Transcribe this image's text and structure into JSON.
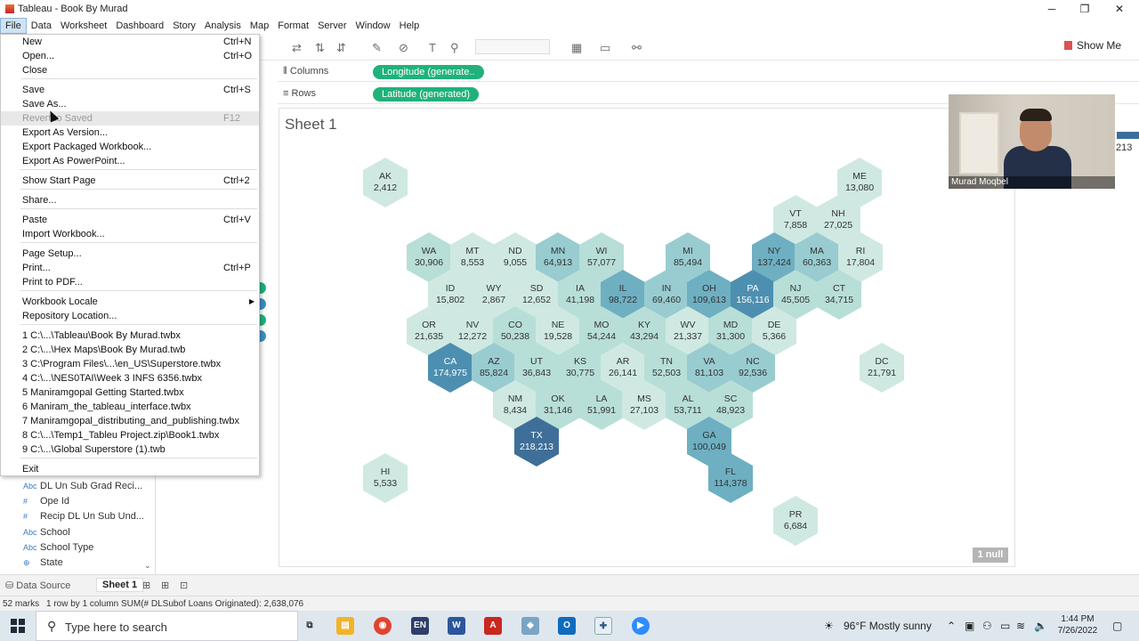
{
  "window": {
    "title": "Tableau - Book By Murad",
    "minimize": "─",
    "maximize": "❐",
    "close": "✕"
  },
  "menubar": [
    "File",
    "Data",
    "Worksheet",
    "Dashboard",
    "Story",
    "Analysis",
    "Map",
    "Format",
    "Server",
    "Window",
    "Help"
  ],
  "file_menu": {
    "items": [
      {
        "label": "New",
        "shortcut": "Ctrl+N"
      },
      {
        "label": "Open...",
        "shortcut": "Ctrl+O"
      },
      {
        "label": "Close",
        "shortcut": ""
      },
      {
        "label": "Save",
        "shortcut": "Ctrl+S"
      },
      {
        "label": "Save As...",
        "shortcut": ""
      },
      {
        "label": "Revert to Saved",
        "shortcut": "F12",
        "disabled": true
      },
      {
        "label": "Export As Version...",
        "shortcut": ""
      },
      {
        "label": "Export Packaged Workbook...",
        "shortcut": ""
      },
      {
        "label": "Export As PowerPoint...",
        "shortcut": ""
      },
      {
        "label": "Show Start Page",
        "shortcut": "Ctrl+2"
      },
      {
        "label": "Share...",
        "shortcut": ""
      },
      {
        "label": "Paste",
        "shortcut": "Ctrl+V"
      },
      {
        "label": "Import Workbook...",
        "shortcut": ""
      },
      {
        "label": "Page Setup...",
        "shortcut": ""
      },
      {
        "label": "Print...",
        "shortcut": "Ctrl+P"
      },
      {
        "label": "Print to PDF...",
        "shortcut": ""
      },
      {
        "label": "Workbook Locale",
        "shortcut": ""
      },
      {
        "label": "Repository Location...",
        "shortcut": ""
      },
      {
        "label": "1 C:\\...\\Tableau\\Book By Murad.twbx",
        "shortcut": ""
      },
      {
        "label": "2 C:\\...\\Hex Maps\\Book By Murad.twb",
        "shortcut": ""
      },
      {
        "label": "3 C:\\Program Files\\...\\en_US\\Superstore.twbx",
        "shortcut": ""
      },
      {
        "label": "4 C:\\...\\NES0TAI\\Week 3 INFS 6356.twbx",
        "shortcut": ""
      },
      {
        "label": "5 Maniramgopal Getting Started.twbx",
        "shortcut": ""
      },
      {
        "label": "6 Maniram_the_tableau_interface.twbx",
        "shortcut": ""
      },
      {
        "label": "7 Maniramgopal_distributing_and_publishing.twbx",
        "shortcut": ""
      },
      {
        "label": "8 C:\\...\\Temp1_Tableu Project.zip\\Book1.twbx",
        "shortcut": ""
      },
      {
        "label": "9 C:\\...\\Global Superstore (1).twb",
        "shortcut": ""
      },
      {
        "label": "Exit",
        "shortcut": ""
      }
    ],
    "submenu_arrow": "▶"
  },
  "toolbar": {
    "show_me": "Show Me"
  },
  "shelves": {
    "columns_label": "Columns",
    "columns_pill": "Longitude (generate..",
    "rows_label": "Rows",
    "rows_pill": "Latitude (generated)"
  },
  "fields": [
    {
      "type": "Abc",
      "name": "DL Un Sub Grad Reci..."
    },
    {
      "type": "#",
      "name": "Ope Id"
    },
    {
      "type": "#",
      "name": "Recip DL Un Sub Und..."
    },
    {
      "type": "Abc",
      "name": "School"
    },
    {
      "type": "Abc",
      "name": "School Type"
    },
    {
      "type": "⊕",
      "name": "State"
    }
  ],
  "sheet_title": "Sheet 1",
  "null_badge": "1 null",
  "hex_colors": {
    "lightest": "#cfe9e2",
    "light": "#b8ded8",
    "mid": "#98ccd0",
    "midDark": "#6eafc2",
    "dark": "#4d8fb0",
    "darkest": "#3f6f99"
  },
  "hexes": [
    {
      "st": "AK",
      "v": "2,412"
    },
    {
      "st": "ME",
      "v": "13,080"
    },
    {
      "st": "VT",
      "v": "7,858"
    },
    {
      "st": "NH",
      "v": "27,025"
    },
    {
      "st": "WA",
      "v": "30,906"
    },
    {
      "st": "MT",
      "v": "8,553"
    },
    {
      "st": "ND",
      "v": "9,055"
    },
    {
      "st": "MN",
      "v": "64,913"
    },
    {
      "st": "WI",
      "v": "57,077"
    },
    {
      "st": "MI",
      "v": "85,494"
    },
    {
      "st": "NY",
      "v": "137,424"
    },
    {
      "st": "MA",
      "v": "60,363"
    },
    {
      "st": "RI",
      "v": "17,804"
    },
    {
      "st": "ID",
      "v": "15,802"
    },
    {
      "st": "WY",
      "v": "2,867"
    },
    {
      "st": "SD",
      "v": "12,652"
    },
    {
      "st": "IA",
      "v": "41,198"
    },
    {
      "st": "IL",
      "v": "98,722"
    },
    {
      "st": "IN",
      "v": "69,460"
    },
    {
      "st": "OH",
      "v": "109,613"
    },
    {
      "st": "PA",
      "v": "156,116"
    },
    {
      "st": "NJ",
      "v": "45,505"
    },
    {
      "st": "CT",
      "v": "34,715"
    },
    {
      "st": "OR",
      "v": "21,635"
    },
    {
      "st": "NV",
      "v": "12,272"
    },
    {
      "st": "CO",
      "v": "50,238"
    },
    {
      "st": "NE",
      "v": "19,528"
    },
    {
      "st": "MO",
      "v": "54,244"
    },
    {
      "st": "KY",
      "v": "43,294"
    },
    {
      "st": "WV",
      "v": "21,337"
    },
    {
      "st": "MD",
      "v": "31,300"
    },
    {
      "st": "DE",
      "v": "5,366"
    },
    {
      "st": "CA",
      "v": "174,975"
    },
    {
      "st": "AZ",
      "v": "85,824"
    },
    {
      "st": "UT",
      "v": "36,843"
    },
    {
      "st": "KS",
      "v": "30,775"
    },
    {
      "st": "AR",
      "v": "26,141"
    },
    {
      "st": "TN",
      "v": "52,503"
    },
    {
      "st": "VA",
      "v": "81,103"
    },
    {
      "st": "NC",
      "v": "92,536"
    },
    {
      "st": "DC",
      "v": "21,791"
    },
    {
      "st": "NM",
      "v": "8,434"
    },
    {
      "st": "OK",
      "v": "31,146"
    },
    {
      "st": "LA",
      "v": "51,991"
    },
    {
      "st": "MS",
      "v": "27,103"
    },
    {
      "st": "AL",
      "v": "53,711"
    },
    {
      "st": "SC",
      "v": "48,923"
    },
    {
      "st": "TX",
      "v": "218,213"
    },
    {
      "st": "GA",
      "v": "100,049"
    },
    {
      "st": "HI",
      "v": "5,533"
    },
    {
      "st": "FL",
      "v": "114,378"
    },
    {
      "st": "PR",
      "v": "6,684"
    }
  ],
  "webcam": {
    "name": "Murad Moqbel"
  },
  "right_peek": {
    "value": "213"
  },
  "tabs": {
    "data_source": "Data Source",
    "sheet": "Sheet 1"
  },
  "status": {
    "marks": "52 marks",
    "rows": "1 row by 1 column",
    "sum": "SUM(# DLSubof Loans Originated): 2,638,076"
  },
  "taskbar": {
    "search_placeholder": "Type here to search",
    "weather": "96°F  Mostly sunny",
    "time": "1:44 PM",
    "date": "7/26/2022"
  }
}
